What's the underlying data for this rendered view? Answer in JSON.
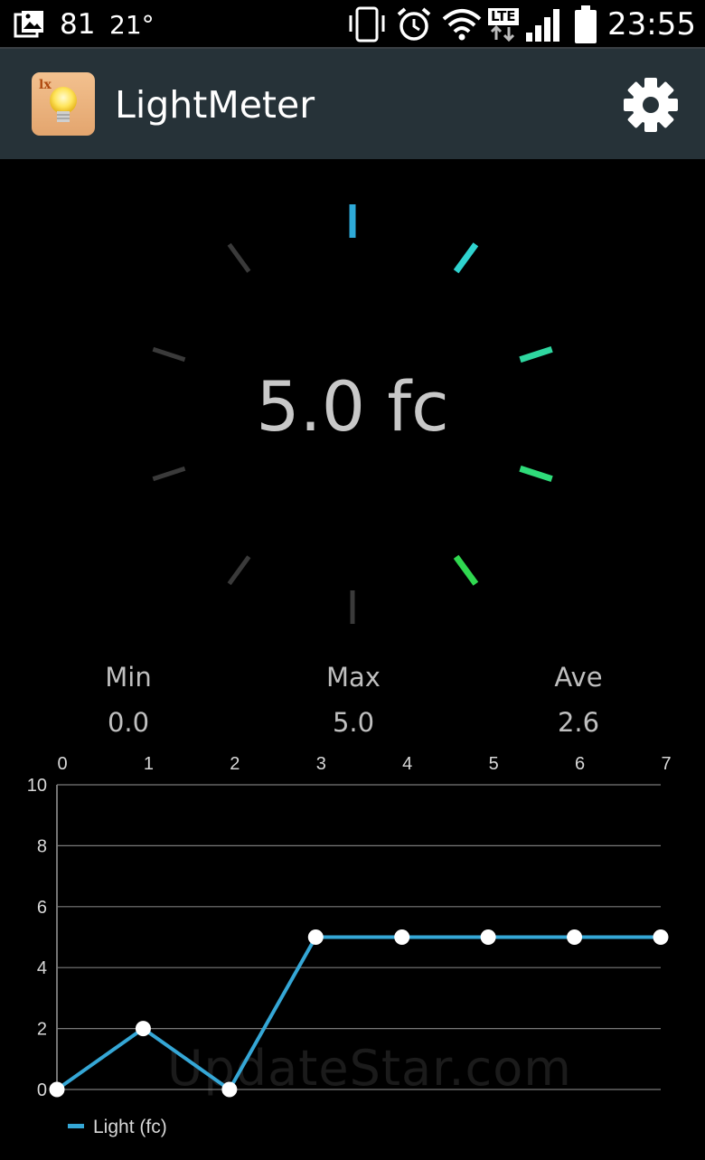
{
  "status_bar": {
    "gallery_icon": "gallery-icon",
    "count": "81",
    "temperature": "21°",
    "lte_label": "LTE",
    "time": "23:55"
  },
  "app_bar": {
    "icon_label": "lx",
    "title": "LightMeter",
    "settings_icon": "gear-icon"
  },
  "meter": {
    "reading": "5.0 fc",
    "active_colors": [
      "#2eaad8",
      "#2fd3cf",
      "#2fd7a0",
      "#2fdc7a",
      "#30d850"
    ],
    "inactive_color": "#3a3a3a"
  },
  "stats": {
    "min_label": "Min",
    "min_value": "0.0",
    "max_label": "Max",
    "max_value": "5.0",
    "ave_label": "Ave",
    "ave_value": "2.6"
  },
  "chart_data": {
    "type": "line",
    "x": [
      0,
      1,
      2,
      3,
      4,
      5,
      6,
      7
    ],
    "series": [
      {
        "name": "Light  (fc)",
        "values": [
          0,
          2,
          0,
          5,
          5,
          5,
          5,
          5
        ],
        "color": "#35a7d6"
      }
    ],
    "x_ticks": [
      "0",
      "1",
      "2",
      "3",
      "4",
      "5",
      "6",
      "7"
    ],
    "y_ticks": [
      "0",
      "2",
      "4",
      "6",
      "8",
      "10"
    ],
    "ylim": [
      0,
      10
    ],
    "xlim": [
      0,
      7
    ],
    "grid": true,
    "legend_placement": "bottom-left"
  },
  "watermark": "UpdateStar.com"
}
